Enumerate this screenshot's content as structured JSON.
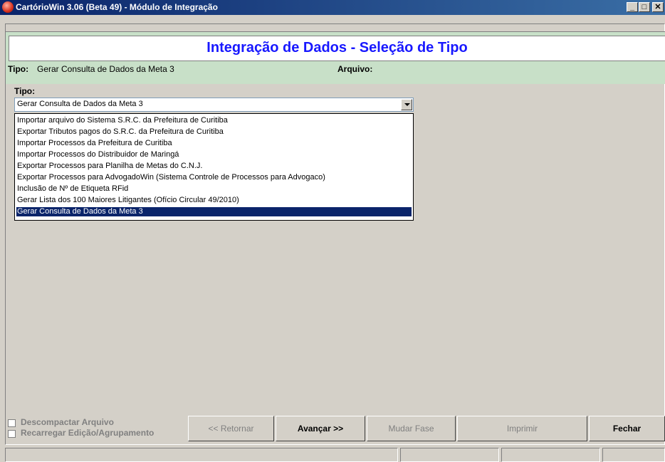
{
  "window": {
    "title": "CartórioWin 3.06 (Beta 49) - Módulo de Integração",
    "app_icon": "cartoriowin-logo-icon",
    "controls": {
      "minimize": "_",
      "maximize": "□",
      "close": "✕"
    }
  },
  "header": {
    "title": "Integração de Dados - Seleção de Tipo",
    "tipo_label": "Tipo:",
    "tipo_value": "Gerar Consulta de Dados da Meta 3",
    "arquivo_label": "Arquivo:",
    "arquivo_value": ""
  },
  "form": {
    "tipo_label": "Tipo:",
    "selected": "Gerar Consulta de Dados da Meta 3",
    "options": [
      "Importar arquivo do Sistema S.R.C. da Prefeitura de Curitiba",
      "Exportar Tributos pagos do S.R.C. da Prefeitura de Curitiba",
      "Importar Processos da Prefeitura de Curitiba",
      "Importar Processos do Distribuidor de Maringá",
      "Exportar Processos para Planilha de Metas do C.N.J.",
      "Exportar Processos para AdvogadoWin (Sistema Controle de Processos para Advogaco)",
      "Inclusão de Nº de Etiqueta RFid",
      "Gerar Lista dos 100 Maiores Litigantes (Ofício Circular 49/2010)",
      "Gerar Consulta de Dados da Meta 3"
    ],
    "selected_index": 8
  },
  "footer": {
    "checkboxes": [
      "Descompactar Arquivo",
      "Recarregar Edição/Agrupamento"
    ],
    "buttons": {
      "retornar": "<<  Retornar",
      "avancar": "Avançar   >>",
      "mudar_fase": "Mudar Fase",
      "imprimir": "Imprimir",
      "fechar": "Fechar"
    }
  },
  "colors": {
    "titlebar": "#0a246a",
    "header_bg": "#c8e0c8",
    "title_text": "#1818ff",
    "selection": "#0a246a",
    "face": "#d4d0c8"
  }
}
